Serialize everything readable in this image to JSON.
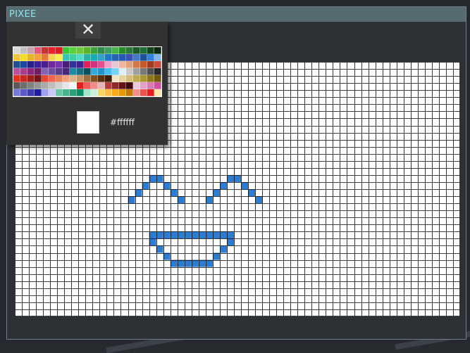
{
  "app": {
    "title": "PIXEE"
  },
  "editor": {
    "grid_cols": 63,
    "grid_rows": 36,
    "background_color": "#ffffff",
    "grid_line_color": "#000000",
    "pixels": [
      {
        "c": "#2b7cd3",
        "cells": [
          [
            19,
            16
          ],
          [
            20,
            16
          ],
          [
            18,
            17
          ],
          [
            21,
            17
          ],
          [
            17,
            18
          ],
          [
            22,
            18
          ],
          [
            16,
            19
          ],
          [
            23,
            19
          ],
          [
            30,
            16
          ],
          [
            31,
            16
          ],
          [
            29,
            17
          ],
          [
            32,
            17
          ],
          [
            28,
            18
          ],
          [
            33,
            18
          ],
          [
            27,
            19
          ],
          [
            34,
            19
          ],
          [
            19,
            24
          ],
          [
            20,
            24
          ],
          [
            21,
            24
          ],
          [
            22,
            24
          ],
          [
            23,
            24
          ],
          [
            24,
            24
          ],
          [
            25,
            24
          ],
          [
            26,
            24
          ],
          [
            27,
            24
          ],
          [
            28,
            24
          ],
          [
            29,
            24
          ],
          [
            30,
            24
          ],
          [
            19,
            25
          ],
          [
            30,
            25
          ],
          [
            20,
            26
          ],
          [
            29,
            26
          ],
          [
            21,
            27
          ],
          [
            28,
            27
          ],
          [
            22,
            28
          ],
          [
            23,
            28
          ],
          [
            24,
            28
          ],
          [
            25,
            28
          ],
          [
            26,
            28
          ],
          [
            27,
            28
          ]
        ]
      }
    ]
  },
  "palette_panel": {
    "close_label": "✕",
    "colors": [
      "#d9d9d9",
      "#bfbfbf",
      "#c8a2b0",
      "#e05a78",
      "#c83232",
      "#e8202a",
      "#d81e1e",
      "#37c837",
      "#56d23c",
      "#6cc83c",
      "#58b428",
      "#3ca03c",
      "#2f8c4a",
      "#3ca058",
      "#46b446",
      "#288c28",
      "#2d7837",
      "#1e5a28",
      "#1e6e3c",
      "#14461e",
      "#0a280f",
      "#f0c832",
      "#f5dc28",
      "#e6b428",
      "#f0a03c",
      "#e67832",
      "#f5d25a",
      "#faf050",
      "#32c8b4",
      "#3cd2a0",
      "#50dcc8",
      "#28b4a0",
      "#1eaab4",
      "#32a0c8",
      "#1e78c8",
      "#2864b4",
      "#285ab4",
      "#3c50b4",
      "#4678c8",
      "#1e5096",
      "#3282dc",
      "#82b4e6",
      "#1e5096",
      "#1e46a0",
      "#281e8c",
      "#3c1e96",
      "#4b1e8c",
      "#6e28a0",
      "#7832b4",
      "#461e78",
      "#3232a0",
      "#461e96",
      "#e61e5a",
      "#d2327d",
      "#e6508c",
      "#f0a0c8",
      "#e6c8d2",
      "#f0b4a0",
      "#e6a078",
      "#d27846",
      "#c85a28",
      "#a03c1e",
      "#d24b3c",
      "#be50a0",
      "#aa3c8c",
      "#8c2878",
      "#6e1e64",
      "#8264b4",
      "#6e50a0",
      "#5a3c8c",
      "#46287d",
      "#1e8ca0",
      "#1e6e82",
      "#0a505a",
      "#32aadc",
      "#1e96c8",
      "#46bef0",
      "#78d2f5",
      "#dcf0fa",
      "#c8c8c8",
      "#a0a0a0",
      "#787878",
      "#505050",
      "#282828",
      "#e6321e",
      "#c8281e",
      "#a01e1e",
      "#781414",
      "#e64632",
      "#f06450",
      "#e6825a",
      "#f0a078",
      "#dcb48c",
      "#c89664",
      "#a06e3c",
      "#7d501e",
      "#5a320f",
      "#3c1e0a",
      "#f0e6c8",
      "#e6d2a0",
      "#d2be78",
      "#beaa50",
      "#aa9632",
      "#8c7819",
      "#6e5a0a",
      "#5a5a5a",
      "#6e6e6e",
      "#828282",
      "#969696",
      "#aaaaaa",
      "#bebebe",
      "#d2d2d2",
      "#e6e6e6",
      "#fafafa",
      "#e01e1e",
      "#f05a5a",
      "#f08c8c",
      "#e6b4b4",
      "#b43c3c",
      "#8c2828",
      "#641414",
      "#3c0a0a",
      "#f0c8dc",
      "#e6a0c8",
      "#dc78b4",
      "#d250a0",
      "#7878dc",
      "#5a5ac8",
      "#3c3cb4",
      "#1e1ea0",
      "#a0a0f0",
      "#c8c8fa",
      "#64c8a0",
      "#46b48c",
      "#28a078",
      "#0a8c64",
      "#a0e6c8",
      "#c8f0dc",
      "#ffd264",
      "#ffbe3c",
      "#ffaa14",
      "#e69600",
      "#c87800",
      "#fa8c8c",
      "#f05050",
      "#e61e1e",
      "#ffe6aa"
    ],
    "selected_color": "#ffffff",
    "selected_hex": "#ffffff"
  }
}
